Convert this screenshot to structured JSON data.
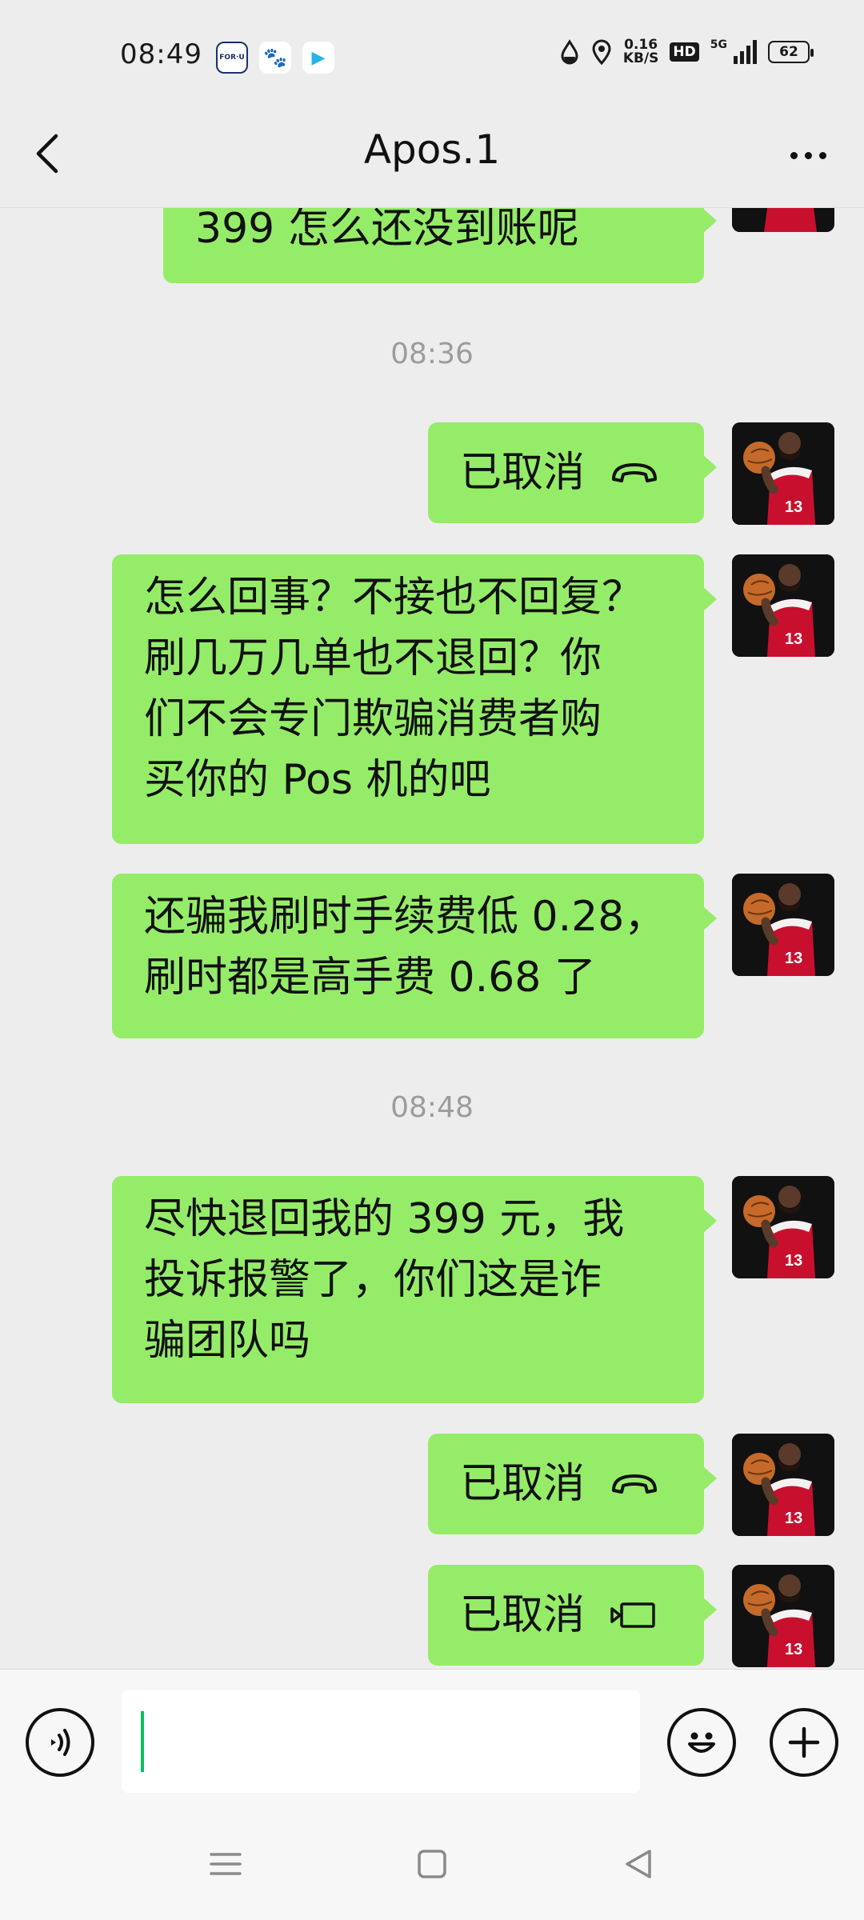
{
  "status_bar": {
    "time": "08:49",
    "app_icons": [
      {
        "name": "foru-app-icon",
        "label": "FOR·U"
      },
      {
        "name": "baidu-app-icon",
        "label": "🐾"
      },
      {
        "name": "video-app-icon",
        "label": "▶"
      }
    ],
    "net_speed_value": "0.16",
    "net_speed_unit": "KB/S",
    "hd_label": "HD",
    "signal_label": "5G",
    "battery_level": "62"
  },
  "header": {
    "title": "Apos.1"
  },
  "messages": [
    {
      "type": "text",
      "text": "399 怎么还没到账呢"
    },
    {
      "type": "time",
      "text": "08:36"
    },
    {
      "type": "voice_call",
      "text": "已取消"
    },
    {
      "type": "text",
      "lines": [
        "怎么回事？不接也不回复？",
        "刷几万几单也不退回？你",
        "们不会专门欺骗消费者购",
        "买你的 Pos 机的吧"
      ]
    },
    {
      "type": "text",
      "lines": [
        "还骗我刷时手续费低 0.28，",
        "刷时都是高手费 0.68 了"
      ]
    },
    {
      "type": "time",
      "text": "08:48"
    },
    {
      "type": "text",
      "lines": [
        "尽快退回我的 399 元，我",
        "投诉报警了，你们这是诈",
        "骗团队吗"
      ]
    },
    {
      "type": "voice_call",
      "text": "已取消"
    },
    {
      "type": "video_call",
      "text": "已取消"
    }
  ],
  "colors": {
    "bubble": "#95ec69",
    "background": "#ededed",
    "caret": "#07c160"
  }
}
